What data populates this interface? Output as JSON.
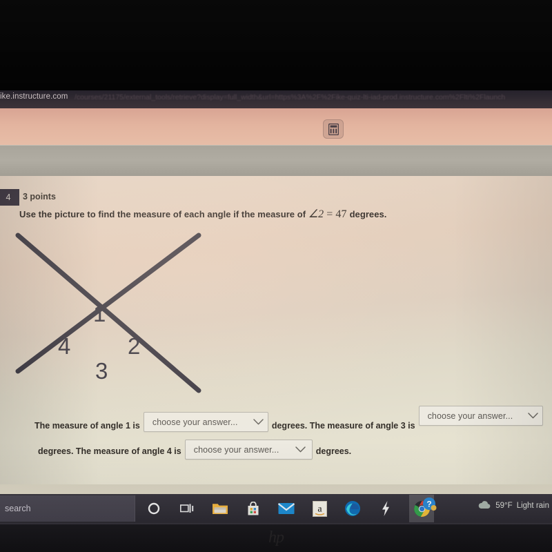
{
  "browser": {
    "url_host": "ike.instructure.com",
    "url_path": "/courses/21175/external_tools/retrieve?display=full_width&url=https%3A%2F%2Fike-quiz-lti-iad-prod.instructure.com%2Flti%2Flaunch"
  },
  "toolbar": {
    "calculator_label": "calculator"
  },
  "question": {
    "number": "4",
    "points": "3 points",
    "prompt_prefix": "Use the picture to find the measure of each angle if the measure of ",
    "prompt_math_angle": "∠2",
    "prompt_math_equals": " = 47 ",
    "prompt_suffix": "degrees.",
    "figure": {
      "angle_labels": [
        "1",
        "2",
        "3",
        "4"
      ],
      "description": "two intersecting lines forming an X"
    },
    "rows": [
      {
        "lead": "The measure of angle 1 is",
        "dropdown": "choose your answer...",
        "mid": "degrees. The measure of angle 3 is",
        "dropdown2": "choose your answer..."
      },
      {
        "lead": "degrees. The measure of angle 4 is",
        "dropdown": "choose your answer...",
        "tail": "degrees."
      }
    ]
  },
  "taskbar": {
    "search_placeholder": "search",
    "icons": [
      "cortana-icon",
      "task-view-icon",
      "file-explorer-icon",
      "microsoft-store-icon",
      "mail-icon",
      "amazon-icon",
      "edge-icon",
      "lightning-icon",
      "chrome-icon"
    ],
    "tray": {
      "help_icon": "help-icon",
      "weather_temp": "59°F",
      "weather_desc": "Light rain"
    }
  },
  "device": {
    "brand": "hp"
  },
  "colors": {
    "toolbar_band": "#e3b49f",
    "content_bg": "#e3cfbd",
    "taskbar": "#333139",
    "badge": "#3a3440",
    "figure_line": "#3c3a44"
  }
}
